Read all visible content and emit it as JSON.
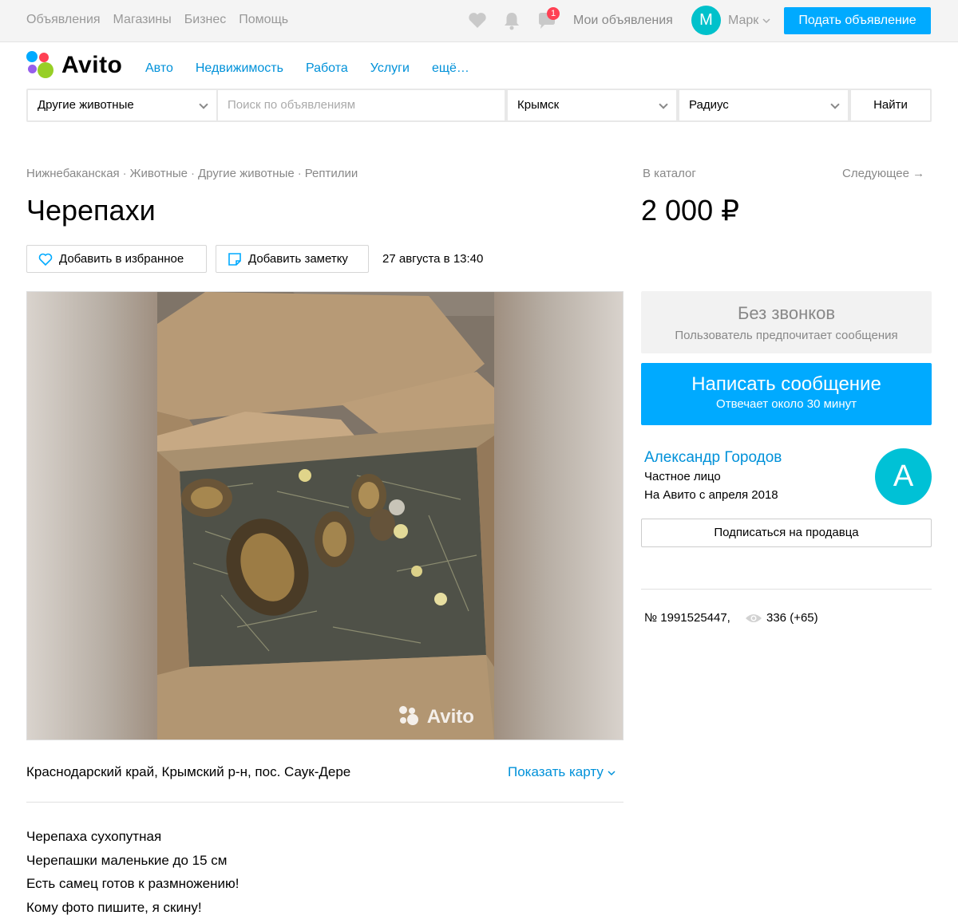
{
  "topnav": {
    "items": [
      "Объявления",
      "Магазины",
      "Бизнес",
      "Помощь"
    ],
    "notification_count": "1",
    "my_ads": "Мои объявления",
    "avatar_letter": "М",
    "user_name": "Марк",
    "post_button": "Подать объявление"
  },
  "logo": {
    "text": "Avito"
  },
  "categories": [
    "Авто",
    "Недвижимость",
    "Работа",
    "Услуги",
    "ещё…"
  ],
  "search": {
    "category": "Другие животные",
    "placeholder": "Поиск по объявлениям",
    "city": "Крымск",
    "radius": "Радиус",
    "submit": "Найти"
  },
  "breadcrumbs": [
    "Нижнебаканская",
    "Животные",
    "Другие животные",
    "Рептилии"
  ],
  "catalog_link": "В каталог",
  "next_link": "Следующее →",
  "listing": {
    "title": "Черепахи",
    "price": "2 000 ₽",
    "add_favorite": "Добавить в избранное",
    "add_note": "Добавить заметку",
    "date": "27 августа в 13:40",
    "photo_watermark": "Avito",
    "address": "Краснодарский край, Крымский р-н, пос. Саук-Дере",
    "show_map": "Показать карту",
    "description": [
      "Черепаха сухопутная",
      "Черепашки маленькие до 15 см",
      "Есть самец готов к размножению!",
      "Кому фото пишите, я скину!"
    ]
  },
  "contact": {
    "no_calls_title": "Без звонков",
    "no_calls_subtitle": "Пользователь предпочитает сообщения",
    "message_button": "Написать сообщение",
    "message_subtitle": "Отвечает около 30 минут"
  },
  "seller": {
    "name": "Александр Городов",
    "type": "Частное лицо",
    "since": "На Авито с апреля 2018",
    "avatar_letter": "А",
    "subscribe": "Подписаться на продавца"
  },
  "meta": {
    "ad_number": "№ 1991525447,",
    "views": "336 (+65)"
  },
  "colors": {
    "accent": "#00aaff",
    "link": "#0091d9",
    "avatar": "#00c1cb",
    "badge": "#ff4053"
  }
}
